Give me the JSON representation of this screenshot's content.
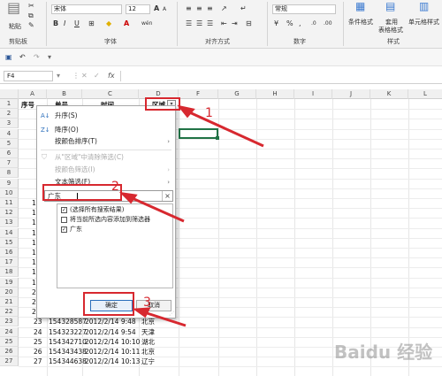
{
  "ribbon": {
    "paste_label": "粘贴",
    "font_name": "宋体",
    "font_size": "12",
    "font_bold": "B",
    "font_italic": "I",
    "font_underline": "U",
    "font_grow": "A",
    "font_shrink": "A",
    "wen": "wén",
    "number_format": "常规",
    "cond_format_label": "条件格式",
    "table_format_line1": "套用",
    "table_format_line2": "表格格式",
    "cell_style_label": "单元格样式",
    "groups": {
      "clipboard": "剪贴板",
      "font": "字体",
      "alignment": "对齐方式",
      "number": "数字",
      "styles": "样式"
    }
  },
  "formula_bar": {
    "name_box": "F4",
    "fx": "fx"
  },
  "columns": [
    "A",
    "B",
    "C",
    "D",
    "F",
    "G",
    "H",
    "I",
    "J",
    "K",
    "L"
  ],
  "row_numbers": [
    "1",
    "2",
    "3",
    "4",
    "5",
    "6",
    "7",
    "8",
    "9",
    "10",
    "11",
    "12",
    "13",
    "14",
    "15",
    "16",
    "17",
    "18",
    "19",
    "20",
    "21",
    "22",
    "23",
    "24",
    "25",
    "26",
    "27"
  ],
  "header_row": {
    "a": "序号",
    "b": "单号",
    "c": "时间",
    "d": "区域"
  },
  "left_col_values": [
    "1",
    "1",
    "1",
    "1",
    "1",
    "1",
    "1",
    "1",
    "1",
    "2",
    "2",
    "2"
  ],
  "data_rows": [
    {
      "seq": "23",
      "order": "154328587",
      "time": "2012/2/14  9:48",
      "region": "北京"
    },
    {
      "seq": "24",
      "order": "154323227",
      "time": "2012/2/14  9:54",
      "region": "天津"
    },
    {
      "seq": "25",
      "order": "154342710",
      "time": "2012/2/14 10:10",
      "region": "湖北"
    },
    {
      "seq": "26",
      "order": "154343438",
      "time": "2012/2/14 10:11",
      "region": "北京"
    },
    {
      "seq": "27",
      "order": "154344638",
      "time": "2012/2/14 10:13",
      "region": "辽宁"
    }
  ],
  "filter_menu": {
    "sort_asc": "升序(S)",
    "sort_desc": "降序(O)",
    "sort_color": "按颜色排序(T)",
    "clear_filter": "从\"区域\"中清除筛选(C)",
    "filter_color": "按颜色筛选(I)",
    "text_filter": "文本筛选(F)",
    "search_value": "广东",
    "search_icon": "×",
    "options": [
      {
        "label": "(选择所有搜索结果)",
        "checked": true
      },
      {
        "label": "将当前所选内容添加到筛选器",
        "checked": false
      },
      {
        "label": "广东",
        "checked": true
      }
    ],
    "ok": "确定",
    "cancel": "取消"
  },
  "annotations": {
    "one": "1",
    "two": "2",
    "three": "3"
  },
  "watermark": "Baidu 经验",
  "colors": {
    "annotation_red": "#d7282f",
    "selected_cell": "#217346"
  }
}
